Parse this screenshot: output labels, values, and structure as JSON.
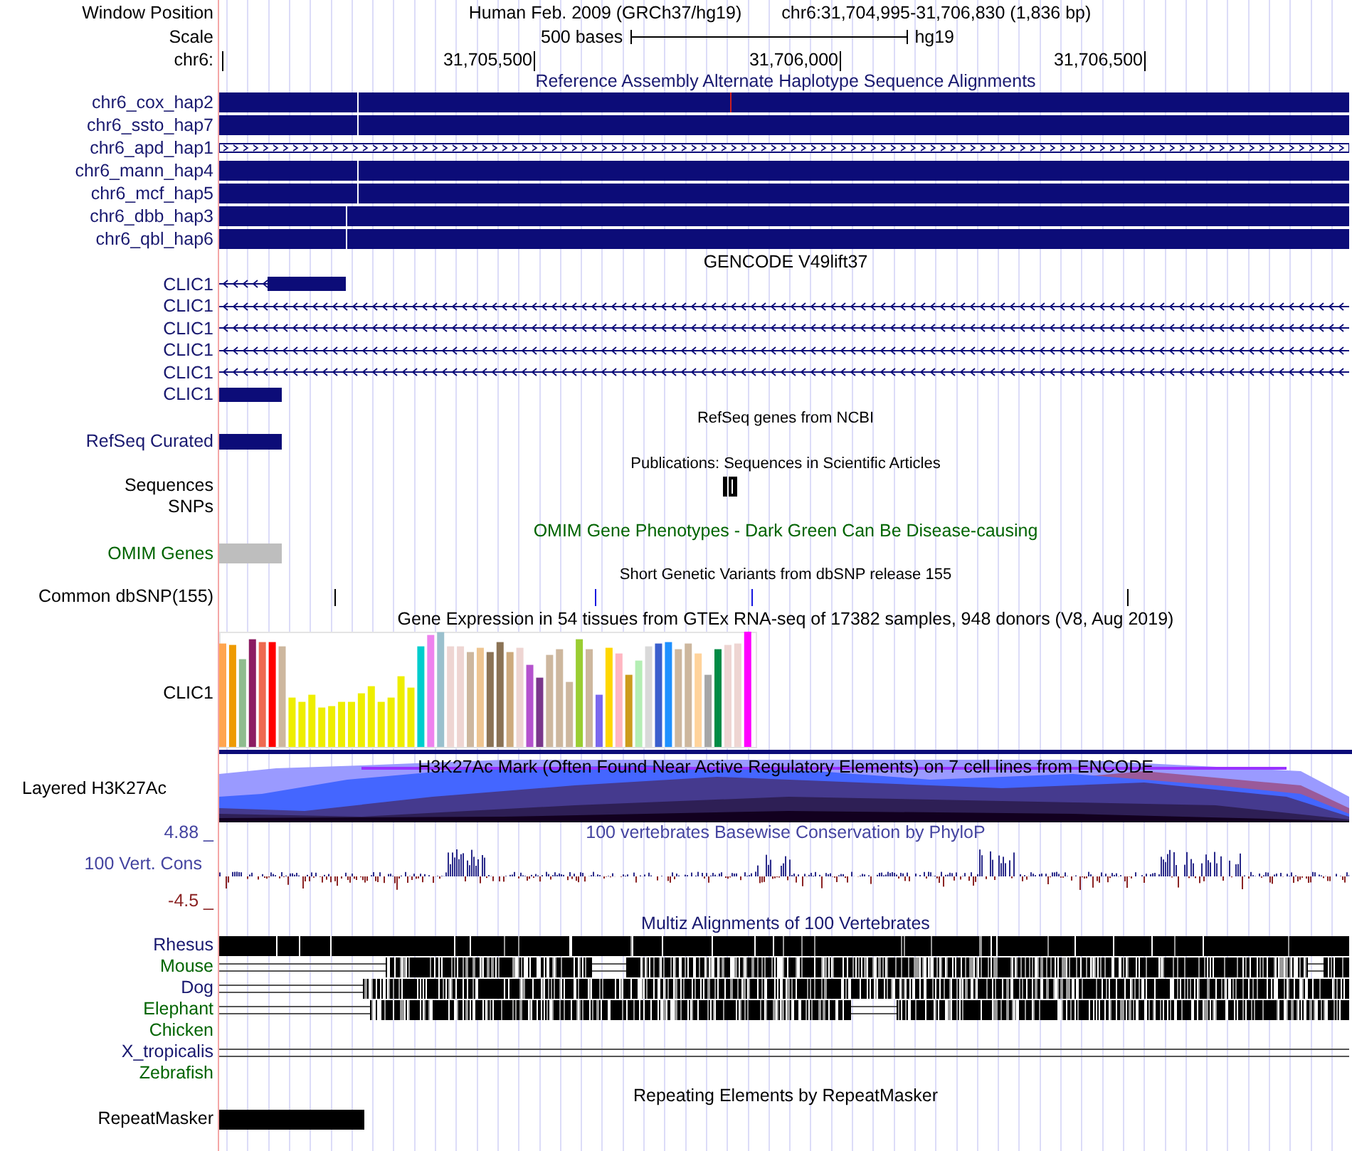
{
  "position_bar": {
    "label": "Window Position",
    "assembly": "Human Feb. 2009 (GRCh37/hg19)",
    "position": "chr6:31,704,995-31,706,830 (1,836 bp)"
  },
  "scale_bar": {
    "label": "Scale",
    "length": "500 bases",
    "database": "hg19"
  },
  "base_ruler": {
    "label": "chr6:",
    "ticks": [
      "31,705,500",
      "31,706,000",
      "31,706,500"
    ]
  },
  "tracks": [
    {
      "kind": "alt_haplotypes",
      "title": {
        "text": "Reference Assembly Alternate Haplotype Sequence Alignments",
        "color": "#18186f"
      },
      "rows": [
        {
          "label": "chr6_cox_hap2",
          "color": "#18186f",
          "kind": "solid"
        },
        {
          "label": "chr6_ssto_hap7",
          "color": "#18186f",
          "kind": "solid"
        },
        {
          "label": "chr6_apd_hap1",
          "color": "#18186f",
          "kind": "chevron"
        },
        {
          "label": "chr6_mann_hap4",
          "color": "#18186f",
          "kind": "solid"
        },
        {
          "label": "chr6_mcf_hap5",
          "color": "#18186f",
          "kind": "solid"
        },
        {
          "label": "chr6_dbb_hap3",
          "color": "#18186f",
          "kind": "solid"
        },
        {
          "label": "chr6_qbl_hap6",
          "color": "#18186f",
          "kind": "solid"
        }
      ]
    },
    {
      "kind": "gencode",
      "title": {
        "text": "GENCODE V49lift37",
        "color": "#000000"
      },
      "rows": [
        {
          "label": "CLIC1",
          "color": "#18186f",
          "kind": "tail"
        },
        {
          "label": "CLIC1",
          "color": "#18186f",
          "kind": "intron"
        },
        {
          "label": "CLIC1",
          "color": "#18186f",
          "kind": "intron"
        },
        {
          "label": "CLIC1",
          "color": "#18186f",
          "kind": "intron"
        },
        {
          "label": "CLIC1",
          "color": "#18186f",
          "kind": "intron"
        },
        {
          "label": "CLIC1",
          "color": "#18186f",
          "kind": "exon"
        }
      ]
    },
    {
      "kind": "refseq",
      "title": {
        "text": "RefSeq genes from NCBI",
        "color": "#000000"
      },
      "rows": [
        {
          "label": "RefSeq Curated",
          "color": "#18186f"
        }
      ]
    },
    {
      "kind": "publications",
      "title": {
        "text": "Publications: Sequences in Scientific Articles",
        "color": "#000000"
      },
      "rows": [
        {
          "label": "Sequences",
          "color": "#000000"
        },
        {
          "label": "SNPs",
          "color": "#000000"
        }
      ]
    },
    {
      "kind": "omim",
      "title": {
        "text": "OMIM Gene Phenotypes - Dark Green Can Be Disease-causing",
        "color": "#006400"
      },
      "rows": [
        {
          "label": "OMIM Genes",
          "color": "#006400"
        }
      ]
    },
    {
      "kind": "dbsnp",
      "title": {
        "text": "Short Genetic Variants from dbSNP release 155",
        "color": "#000000"
      },
      "rows": [
        {
          "label": "Common dbSNP(155)",
          "color": "#000000"
        }
      ]
    },
    {
      "kind": "gtex",
      "title": {
        "text": "Gene Expression in 54 tissues from GTEx RNA-seq of 17382 samples, 948 donors (V8, Aug 2019)",
        "color": "#000000"
      },
      "rows": [
        {
          "label": "CLIC1",
          "color": "#000000"
        }
      ]
    },
    {
      "kind": "h3k27ac",
      "title": {
        "text": "H3K27Ac Mark (Often Found Near Active Regulatory Elements) on 7 cell lines from ENCODE",
        "color": "#000000"
      },
      "rows": [
        {
          "label": "Layered H3K27Ac",
          "color": "#000000"
        }
      ]
    },
    {
      "kind": "phylop",
      "title": {
        "text": "100 vertebrates Basewise Conservation by PhyloP",
        "color": "#4444a0"
      },
      "y_max": "4.88 _",
      "y_min": "-4.5 _",
      "rows": [
        {
          "label": "100 Vert. Cons",
          "color": "#4444a0"
        }
      ]
    },
    {
      "kind": "multiz",
      "title": {
        "text": "Multiz Alignments of 100 Vertebrates",
        "color": "#18186f"
      },
      "rows": [
        {
          "label": "Rhesus",
          "color": "#18186f",
          "kind": "aligned"
        },
        {
          "label": "Mouse",
          "color": "#006400",
          "kind": "aligned"
        },
        {
          "label": "Dog",
          "color": "#18186f",
          "kind": "aligned"
        },
        {
          "label": "Elephant",
          "color": "#006400",
          "kind": "aligned"
        },
        {
          "label": "Chicken",
          "color": "#006400",
          "kind": "empty"
        },
        {
          "label": "X_tropicalis",
          "color": "#18186f",
          "kind": "lines"
        },
        {
          "label": "Zebrafish",
          "color": "#006400",
          "kind": "empty"
        }
      ]
    },
    {
      "kind": "repeatmasker",
      "title": {
        "text": "Repeating Elements by RepeatMasker",
        "color": "#000000"
      },
      "rows": [
        {
          "label": "RepeatMasker",
          "color": "#000000"
        }
      ]
    }
  ]
}
